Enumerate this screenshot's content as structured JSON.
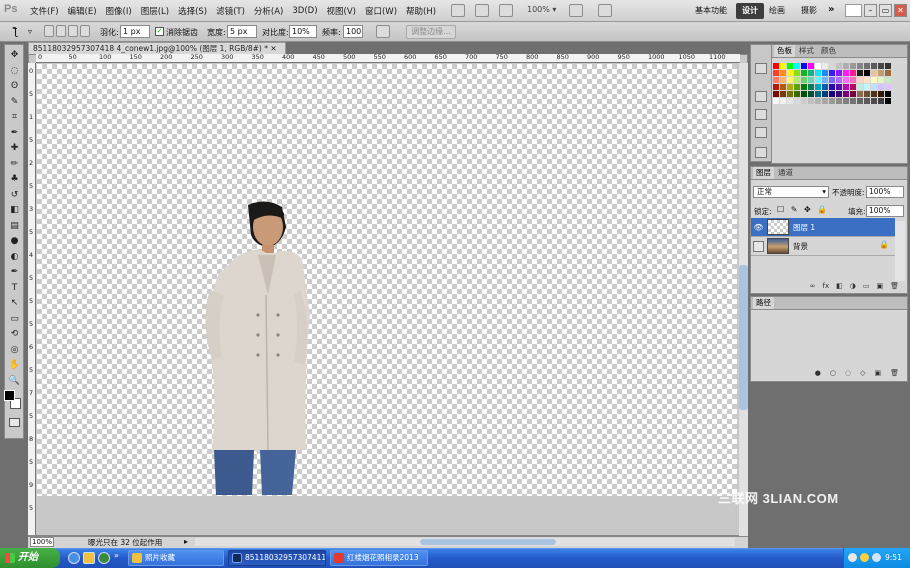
{
  "app": {
    "logo": "Ps"
  },
  "menu": [
    "文件(F)",
    "编辑(E)",
    "图像(I)",
    "图层(L)",
    "选择(S)",
    "滤镜(T)",
    "分析(A)",
    "3D(D)",
    "视图(V)",
    "窗口(W)",
    "帮助(H)"
  ],
  "appbar": {
    "zoom": "100%",
    "zoom_arrow": "▾"
  },
  "workspaces": {
    "basic": "基本功能",
    "design": "设计",
    "paint": "绘画",
    "photo": "摄影",
    "more": "»"
  },
  "window_controls": {
    "minimize": "–",
    "restore": "▭",
    "close": "✕"
  },
  "options": {
    "tool_glyph": "▿",
    "feather_label": "羽化:",
    "feather_value": "1 px",
    "antialias_label": "消除锯齿",
    "antialias_checked": "✓",
    "width_label": "宽度:",
    "width_value": "5 px",
    "contrast_label": "对比度:",
    "contrast_value": "10%",
    "frequency_label": "频率:",
    "frequency_value": "100",
    "refine_edge": "调整边缘..."
  },
  "tools": [
    "move-icon",
    "marquee-icon",
    "lasso-icon",
    "quick-select-icon",
    "crop-icon",
    "eyedropper-icon",
    "healing-icon",
    "brush-icon",
    "stamp-icon",
    "history-brush-icon",
    "eraser-icon",
    "gradient-icon",
    "blur-icon",
    "dodge-icon",
    "pen-icon",
    "type-icon",
    "path-select-icon",
    "shape-icon",
    "3d-rotate-icon",
    "3d-orbit-icon",
    "hand-icon",
    "zoom-icon"
  ],
  "tool_glyphs": [
    "✥",
    "◌",
    "ʘ",
    "✎",
    "⌗",
    "✒",
    "✚",
    "✏",
    "♣",
    "↺",
    "◧",
    "▤",
    "●",
    "◐",
    "✒",
    "T",
    "↖",
    "▭",
    "⟲",
    "◎",
    "✋",
    "🔍"
  ],
  "document": {
    "tab_title": "85118032957307418 4_conew1.jpg@100% (图层 1, RGB/8#) * ✕",
    "status_zoom": "100%",
    "status_text": "曝光只在 32 位起作用",
    "status_arrow": "▸"
  },
  "rulers": {
    "h": [
      "0",
      "50",
      "100",
      "150",
      "200",
      "250",
      "300",
      "350",
      "400",
      "450",
      "500",
      "550",
      "600",
      "650",
      "700",
      "750",
      "800",
      "850",
      "900",
      "950",
      "1000",
      "1050",
      "1100",
      "1150"
    ],
    "v": [
      "0",
      "5",
      "1",
      "5",
      "2",
      "5",
      "3",
      "5",
      "4",
      "5",
      "5",
      "5",
      "6",
      "5",
      "7",
      "5",
      "8",
      "5",
      "9",
      "5"
    ]
  },
  "swatches_panel": {
    "tabs": [
      "色板",
      "样式",
      "颜色"
    ],
    "colors": [
      "#ff0000",
      "#ffff00",
      "#00ff00",
      "#00ffff",
      "#0000ff",
      "#ff00ff",
      "#ffffff",
      "#ebebeb",
      "#d6d6d6",
      "#c2c2c2",
      "#adadad",
      "#999999",
      "#858585",
      "#707070",
      "#5c5c5c",
      "#474747",
      "#333333",
      "#ff3b2b",
      "#ff8c1a",
      "#fff21a",
      "#8ce01a",
      "#1ab21a",
      "#1ab28c",
      "#1ae0ff",
      "#1a8cff",
      "#3b1aff",
      "#8c1aff",
      "#ff1aff",
      "#ff1a8c",
      "#1f1f1f",
      "#000000",
      "#e6c29d",
      "#c29d6d",
      "#9d6d3b",
      "#ff7a6b",
      "#ffb36b",
      "#fff56b",
      "#b3eb6b",
      "#6bd26b",
      "#6bd2b3",
      "#6beeff",
      "#6bb3ff",
      "#7a6bff",
      "#b36bff",
      "#ff6bff",
      "#ff6bb3",
      "#ffd1c2",
      "#ffe0c2",
      "#fff8c2",
      "#e6f5c2",
      "#c2ebc2",
      "#b31a0a",
      "#b35c0a",
      "#b3a90a",
      "#5ca30a",
      "#0a7a0a",
      "#0a7a5c",
      "#0aa3b3",
      "#0a5cb3",
      "#2a0ab3",
      "#5c0ab3",
      "#b30ab3",
      "#b30a5c",
      "#c2ebe0",
      "#c2f5ff",
      "#c2e0ff",
      "#d1c2ff",
      "#e0c2ff",
      "#7a0a00",
      "#7a3b00",
      "#7a7200",
      "#3b6b00",
      "#004f00",
      "#004f3b",
      "#006b7a",
      "#003b7a",
      "#1a007a",
      "#3b007a",
      "#7a007a",
      "#7a003b",
      "#8c6b4f",
      "#6b4f33",
      "#4f331a",
      "#331a0a",
      "#000000",
      "#ffffff",
      "#f2f2f2",
      "#e6e6e6",
      "#d9d9d9",
      "#cccccc",
      "#bfbfbf",
      "#b3b3b3",
      "#a6a6a6",
      "#999999",
      "#8c8c8c",
      "#808080",
      "#737373",
      "#666666",
      "#595959",
      "#4d4d4d",
      "#404040",
      "#000000"
    ]
  },
  "layers_panel": {
    "tabs": [
      "图层",
      "通道"
    ],
    "blend_mode": "正常",
    "blend_arrow": "▾",
    "opacity_label": "不透明度:",
    "opacity_value": "100%",
    "lock_label": "锁定:",
    "lock_icons": "☐ ✎ ✥ 🔒",
    "fill_label": "填充:",
    "fill_value": "100%",
    "layers": [
      {
        "name": "图层 1",
        "selected": true,
        "eye": "👁"
      },
      {
        "name": "背景",
        "selected": false,
        "eye": "",
        "lock": "🔒"
      }
    ],
    "footer_icons": [
      "∞",
      "fx",
      "◧",
      "◑",
      "▭",
      "▣",
      "🗑"
    ]
  },
  "paths_panel": {
    "tabs": [
      "路径"
    ],
    "footer_icons": [
      "●",
      "○",
      "◌",
      "◇",
      "▣",
      "🗑"
    ]
  },
  "watermark": "三联网 3LIAN.COM",
  "taskbar": {
    "start": "开始",
    "tasks": [
      {
        "label": "照片收藏",
        "active": false
      },
      {
        "label": "85118032957307411",
        "active": true
      },
      {
        "label": "红楼烟花照相录2013",
        "active": false
      }
    ],
    "clock": "9:51"
  }
}
